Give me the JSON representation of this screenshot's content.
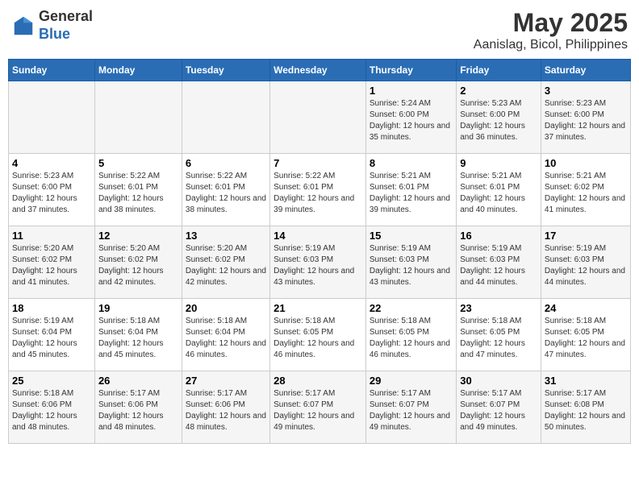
{
  "logo": {
    "general": "General",
    "blue": "Blue"
  },
  "title": "May 2025",
  "subtitle": "Aanislag, Bicol, Philippines",
  "weekdays": [
    "Sunday",
    "Monday",
    "Tuesday",
    "Wednesday",
    "Thursday",
    "Friday",
    "Saturday"
  ],
  "weeks": [
    [
      {
        "day": "",
        "info": ""
      },
      {
        "day": "",
        "info": ""
      },
      {
        "day": "",
        "info": ""
      },
      {
        "day": "",
        "info": ""
      },
      {
        "day": "1",
        "sunrise": "5:24 AM",
        "sunset": "6:00 PM",
        "daylight": "12 hours and 35 minutes."
      },
      {
        "day": "2",
        "sunrise": "5:23 AM",
        "sunset": "6:00 PM",
        "daylight": "12 hours and 36 minutes."
      },
      {
        "day": "3",
        "sunrise": "5:23 AM",
        "sunset": "6:00 PM",
        "daylight": "12 hours and 37 minutes."
      }
    ],
    [
      {
        "day": "4",
        "sunrise": "5:23 AM",
        "sunset": "6:00 PM",
        "daylight": "12 hours and 37 minutes."
      },
      {
        "day": "5",
        "sunrise": "5:22 AM",
        "sunset": "6:01 PM",
        "daylight": "12 hours and 38 minutes."
      },
      {
        "day": "6",
        "sunrise": "5:22 AM",
        "sunset": "6:01 PM",
        "daylight": "12 hours and 38 minutes."
      },
      {
        "day": "7",
        "sunrise": "5:22 AM",
        "sunset": "6:01 PM",
        "daylight": "12 hours and 39 minutes."
      },
      {
        "day": "8",
        "sunrise": "5:21 AM",
        "sunset": "6:01 PM",
        "daylight": "12 hours and 39 minutes."
      },
      {
        "day": "9",
        "sunrise": "5:21 AM",
        "sunset": "6:01 PM",
        "daylight": "12 hours and 40 minutes."
      },
      {
        "day": "10",
        "sunrise": "5:21 AM",
        "sunset": "6:02 PM",
        "daylight": "12 hours and 41 minutes."
      }
    ],
    [
      {
        "day": "11",
        "sunrise": "5:20 AM",
        "sunset": "6:02 PM",
        "daylight": "12 hours and 41 minutes."
      },
      {
        "day": "12",
        "sunrise": "5:20 AM",
        "sunset": "6:02 PM",
        "daylight": "12 hours and 42 minutes."
      },
      {
        "day": "13",
        "sunrise": "5:20 AM",
        "sunset": "6:02 PM",
        "daylight": "12 hours and 42 minutes."
      },
      {
        "day": "14",
        "sunrise": "5:19 AM",
        "sunset": "6:03 PM",
        "daylight": "12 hours and 43 minutes."
      },
      {
        "day": "15",
        "sunrise": "5:19 AM",
        "sunset": "6:03 PM",
        "daylight": "12 hours and 43 minutes."
      },
      {
        "day": "16",
        "sunrise": "5:19 AM",
        "sunset": "6:03 PM",
        "daylight": "12 hours and 44 minutes."
      },
      {
        "day": "17",
        "sunrise": "5:19 AM",
        "sunset": "6:03 PM",
        "daylight": "12 hours and 44 minutes."
      }
    ],
    [
      {
        "day": "18",
        "sunrise": "5:19 AM",
        "sunset": "6:04 PM",
        "daylight": "12 hours and 45 minutes."
      },
      {
        "day": "19",
        "sunrise": "5:18 AM",
        "sunset": "6:04 PM",
        "daylight": "12 hours and 45 minutes."
      },
      {
        "day": "20",
        "sunrise": "5:18 AM",
        "sunset": "6:04 PM",
        "daylight": "12 hours and 46 minutes."
      },
      {
        "day": "21",
        "sunrise": "5:18 AM",
        "sunset": "6:05 PM",
        "daylight": "12 hours and 46 minutes."
      },
      {
        "day": "22",
        "sunrise": "5:18 AM",
        "sunset": "6:05 PM",
        "daylight": "12 hours and 46 minutes."
      },
      {
        "day": "23",
        "sunrise": "5:18 AM",
        "sunset": "6:05 PM",
        "daylight": "12 hours and 47 minutes."
      },
      {
        "day": "24",
        "sunrise": "5:18 AM",
        "sunset": "6:05 PM",
        "daylight": "12 hours and 47 minutes."
      }
    ],
    [
      {
        "day": "25",
        "sunrise": "5:18 AM",
        "sunset": "6:06 PM",
        "daylight": "12 hours and 48 minutes."
      },
      {
        "day": "26",
        "sunrise": "5:17 AM",
        "sunset": "6:06 PM",
        "daylight": "12 hours and 48 minutes."
      },
      {
        "day": "27",
        "sunrise": "5:17 AM",
        "sunset": "6:06 PM",
        "daylight": "12 hours and 48 minutes."
      },
      {
        "day": "28",
        "sunrise": "5:17 AM",
        "sunset": "6:07 PM",
        "daylight": "12 hours and 49 minutes."
      },
      {
        "day": "29",
        "sunrise": "5:17 AM",
        "sunset": "6:07 PM",
        "daylight": "12 hours and 49 minutes."
      },
      {
        "day": "30",
        "sunrise": "5:17 AM",
        "sunset": "6:07 PM",
        "daylight": "12 hours and 49 minutes."
      },
      {
        "day": "31",
        "sunrise": "5:17 AM",
        "sunset": "6:08 PM",
        "daylight": "12 hours and 50 minutes."
      }
    ]
  ]
}
